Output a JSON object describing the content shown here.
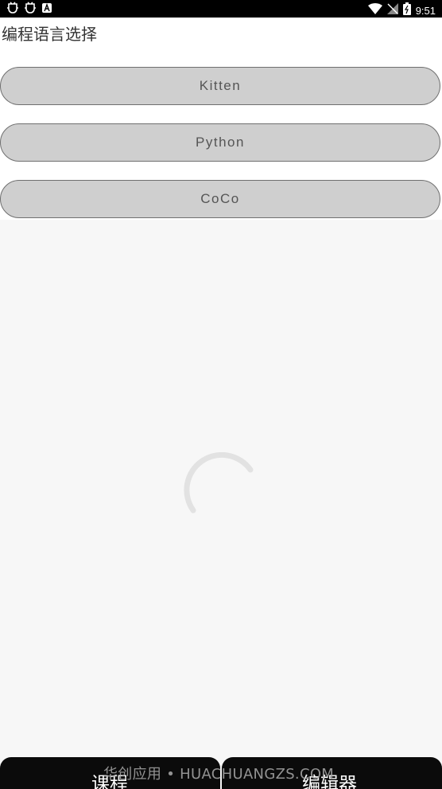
{
  "status_bar": {
    "time": "9:51",
    "icons": [
      "bug-icon",
      "bug-icon",
      "font-icon",
      "wifi-icon",
      "signal-icon",
      "battery-icon"
    ]
  },
  "header": {
    "title": "编程语言选择"
  },
  "languages": [
    "Kitten",
    "Python",
    "CoCo"
  ],
  "bottom_nav": {
    "tab_1": "课程",
    "tab_2": "编辑器"
  },
  "watermark": "华创应用 • HUACHUANGZS.COM"
}
